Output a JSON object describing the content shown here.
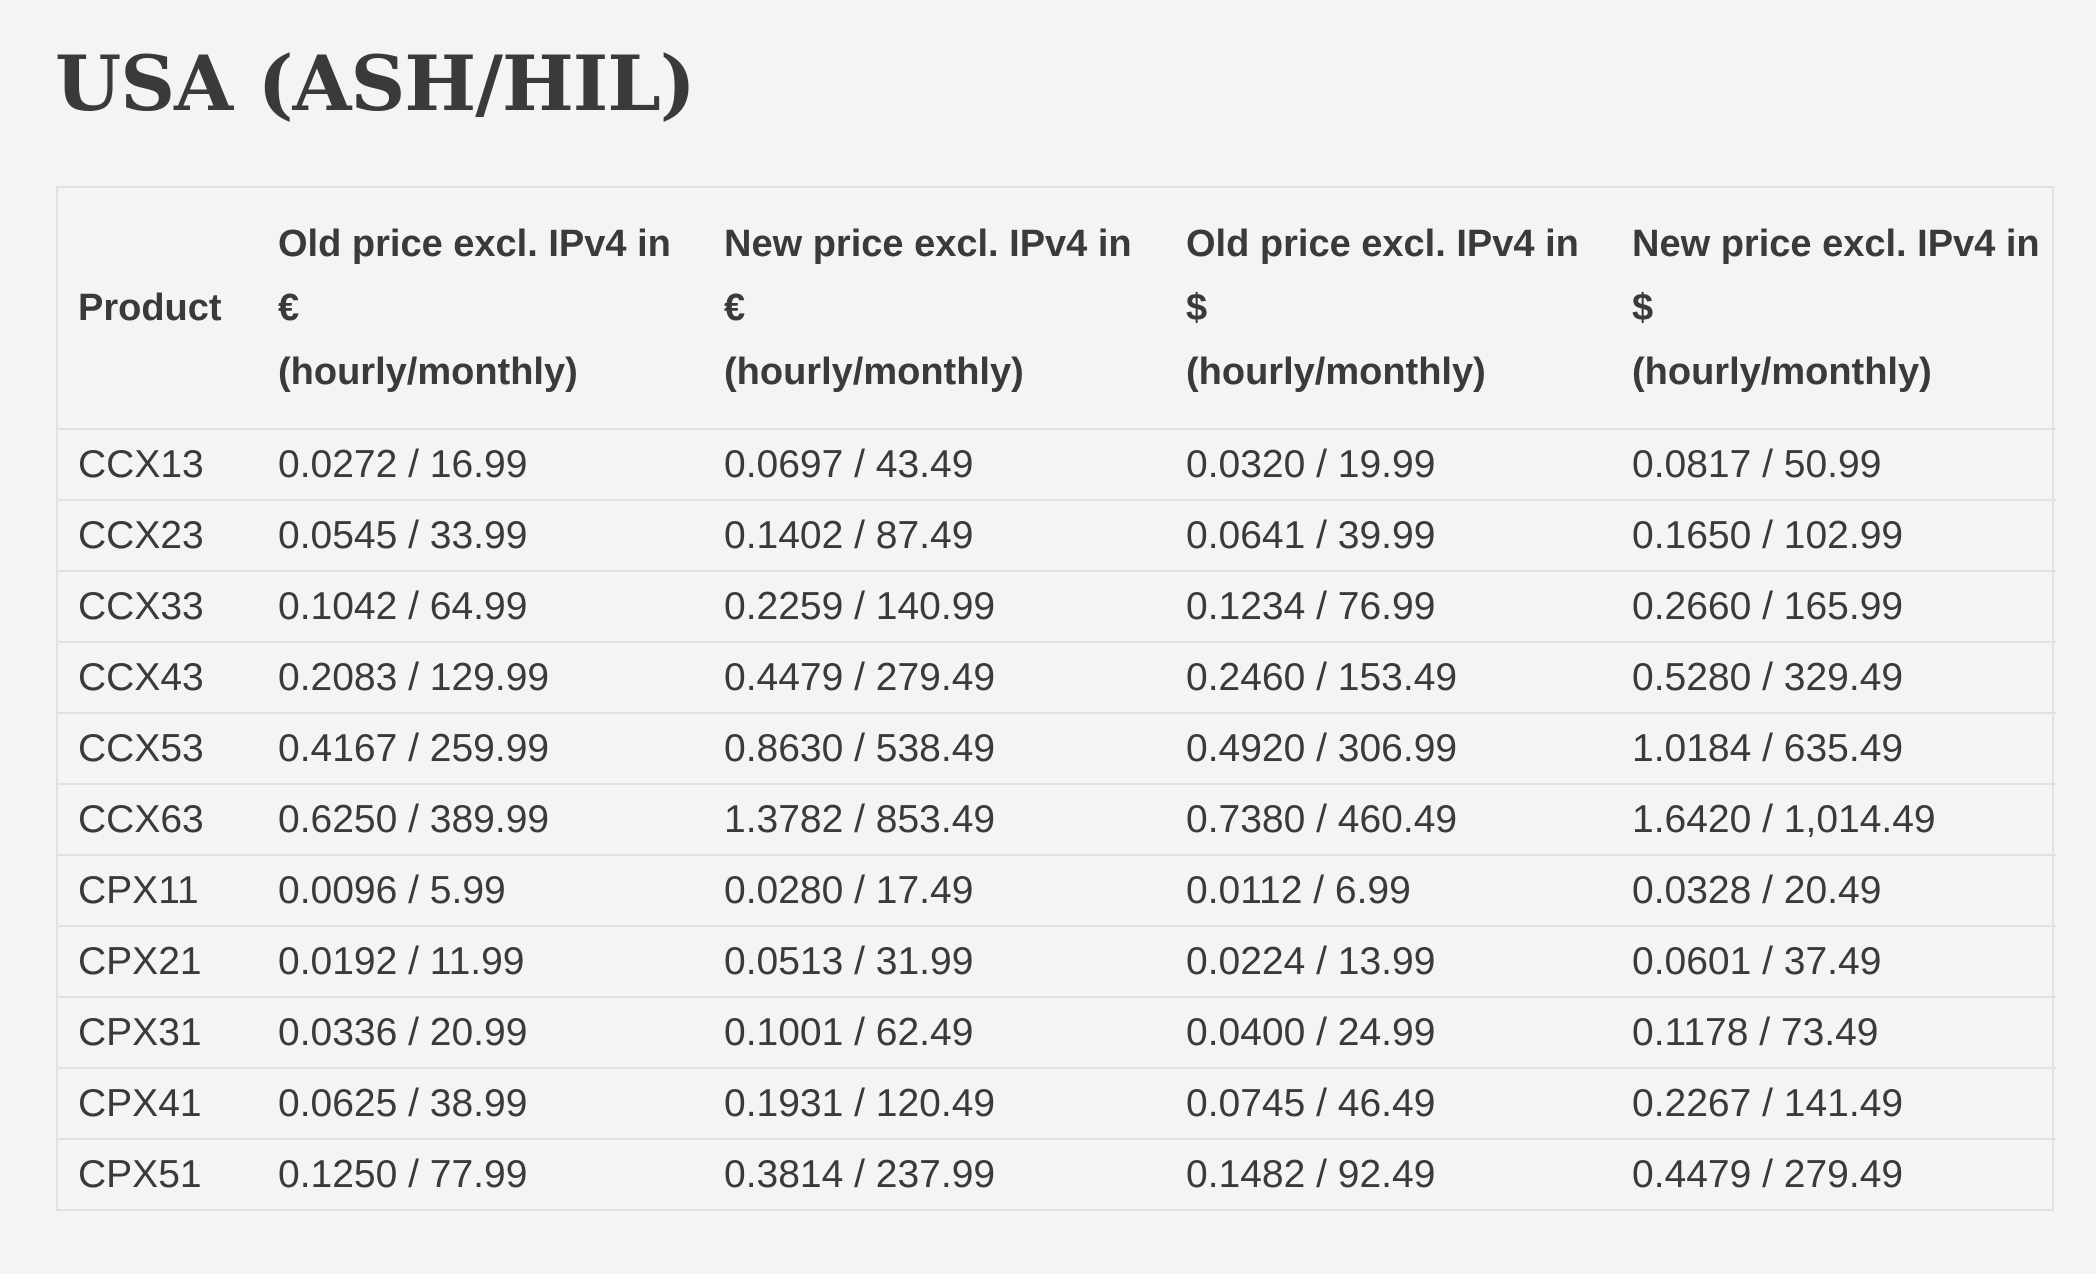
{
  "page": {
    "title": "USA (ASH/HIL)"
  },
  "table": {
    "headers": [
      {
        "lines": [
          "Product"
        ]
      },
      {
        "lines": [
          "Old price excl. IPv4 in",
          "€",
          "(hourly/monthly)"
        ]
      },
      {
        "lines": [
          "New price excl. IPv4 in",
          "€",
          "(hourly/monthly)"
        ]
      },
      {
        "lines": [
          "Old price excl. IPv4 in",
          "$",
          "(hourly/monthly)"
        ]
      },
      {
        "lines": [
          "New price excl. IPv4 in",
          "$",
          "(hourly/monthly)"
        ]
      }
    ],
    "rows": [
      [
        "CCX13",
        "0.0272 / 16.99",
        "0.0697 / 43.49",
        "0.0320 / 19.99",
        "0.0817 / 50.99"
      ],
      [
        "CCX23",
        "0.0545 / 33.99",
        "0.1402 / 87.49",
        "0.0641 / 39.99",
        "0.1650 / 102.99"
      ],
      [
        "CCX33",
        "0.1042 / 64.99",
        "0.2259 / 140.99",
        "0.1234 / 76.99",
        "0.2660 / 165.99"
      ],
      [
        "CCX43",
        "0.2083 / 129.99",
        "0.4479 / 279.49",
        "0.2460 / 153.49",
        "0.5280 / 329.49"
      ],
      [
        "CCX53",
        "0.4167 / 259.99",
        "0.8630 / 538.49",
        "0.4920 / 306.99",
        "1.0184 / 635.49"
      ],
      [
        "CCX63",
        "0.6250 / 389.99",
        "1.3782 / 853.49",
        "0.7380 / 460.49",
        "1.6420 / 1,014.49"
      ],
      [
        "CPX11",
        "0.0096 / 5.99",
        "0.0280 / 17.49",
        "0.0112 / 6.99",
        "0.0328 / 20.49"
      ],
      [
        "CPX21",
        "0.0192 / 11.99",
        "0.0513 / 31.99",
        "0.0224 / 13.99",
        "0.0601 / 37.49"
      ],
      [
        "CPX31",
        "0.0336 / 20.99",
        "0.1001 / 62.49",
        "0.0400 / 24.99",
        "0.1178 / 73.49"
      ],
      [
        "CPX41",
        "0.0625 / 38.99",
        "0.1931 / 120.49",
        "0.0745 / 46.49",
        "0.2267 / 141.49"
      ],
      [
        "CPX51",
        "0.1250 / 77.99",
        "0.3814 / 237.99",
        "0.1482 / 92.49",
        "0.4479 / 279.49"
      ]
    ]
  }
}
